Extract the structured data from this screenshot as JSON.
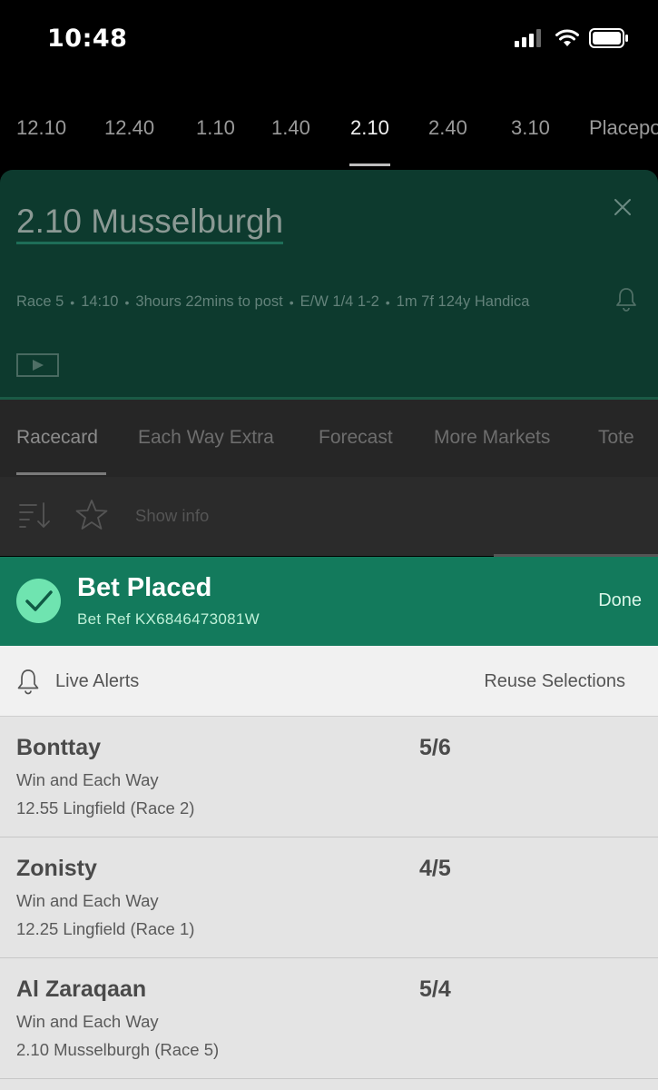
{
  "status_bar": {
    "time": "10:48"
  },
  "race_times": [
    "12.10",
    "12.40",
    "1.10",
    "1.40",
    "2.10",
    "2.40",
    "3.10",
    "Placepot"
  ],
  "race_times_active_index": 4,
  "race": {
    "title": "2.10 Musselburgh",
    "meta": [
      "Race 5",
      "14:10",
      "3hours 22mins to post",
      "E/W 1/4 1-2",
      "1m 7f 124y Handica"
    ]
  },
  "market_tabs": [
    "Racecard",
    "Each Way Extra",
    "Forecast",
    "More Markets",
    "Tote"
  ],
  "market_tabs_active_index": 0,
  "filter": {
    "show_info": "Show info"
  },
  "bet_placed": {
    "title": "Bet Placed",
    "ref": "Bet Ref KX6846473081W",
    "done": "Done"
  },
  "alerts": {
    "live_alerts": "Live Alerts",
    "reuse": "Reuse Selections"
  },
  "selections": [
    {
      "name": "Bonttay",
      "odds": "5/6",
      "bet_type": "Win and Each Way",
      "race": "12.55 Lingfield (Race 2)"
    },
    {
      "name": "Zonisty",
      "odds": "4/5",
      "bet_type": "Win and Each Way",
      "race": "12.25 Lingfield (Race 1)"
    },
    {
      "name": "Al Zaraqaan",
      "odds": "5/4",
      "bet_type": "Win and Each Way",
      "race": "2.10 Musselburgh (Race 5)"
    }
  ],
  "colors": {
    "brand_green": "#137a5c",
    "check_green": "#6fe4b0",
    "race_header_bg": "#0d3a2e"
  }
}
